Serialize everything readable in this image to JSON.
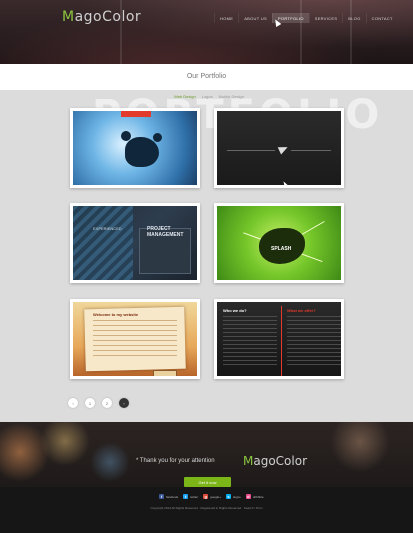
{
  "header": {
    "logo_prefix": "M",
    "logo_rest": "agoColor",
    "nav": [
      "HOME",
      "ABOUT US",
      "PORTFOLIO",
      "SERVICES",
      "BLOG",
      "CONTACT"
    ],
    "active_nav": "PORTFOLIO"
  },
  "page": {
    "title": "Our Portfolio",
    "watermark": "PORTFOLIO"
  },
  "filters": [
    "Web Design",
    "Logos",
    "Mobile Design"
  ],
  "portfolio": {
    "items": [
      {
        "icon": "blue-splatter-thumb",
        "text": ""
      },
      {
        "icon": "paper-plane-thumb",
        "text": ""
      },
      {
        "icon": "project-management-thumb",
        "text": "PROJECT MANAGEMENT",
        "text2": "EXPERIENCED"
      },
      {
        "icon": "green-splash-thumb",
        "text": "SPLASH"
      },
      {
        "icon": "welcome-paper-thumb",
        "text": "Welcome to my website"
      },
      {
        "icon": "dark-who-we-are-thumb",
        "text": "Who we do?",
        "text2": "What we offer?"
      }
    ]
  },
  "pagination": {
    "pages": [
      "‹",
      "1",
      "2",
      "›"
    ],
    "active_index": 3
  },
  "footer": {
    "thanks": "* Thank you for your attention",
    "logo_prefix": "M",
    "logo_rest": "agoColor",
    "cta": "Get it now",
    "social": [
      {
        "label": "facebook",
        "icon": "facebook-icon",
        "color": "#3b5998",
        "glyph": "f"
      },
      {
        "label": "twitter",
        "icon": "twitter-icon",
        "color": "#1da1f2",
        "glyph": "t"
      },
      {
        "label": "google+",
        "icon": "googleplus-icon",
        "color": "#dd4b39",
        "glyph": "g"
      },
      {
        "label": "skype",
        "icon": "skype-icon",
        "color": "#00aff0",
        "glyph": "s"
      },
      {
        "label": "dribbble",
        "icon": "dribbble-icon",
        "color": "#ea4c89",
        "glyph": "d"
      }
    ],
    "copyright": "Copyright 2014 All Rights Reserved · Registered in Rights Reserved · Search / Term"
  },
  "colors": {
    "accent": "#8cc63f",
    "cta": "#7cb518"
  }
}
